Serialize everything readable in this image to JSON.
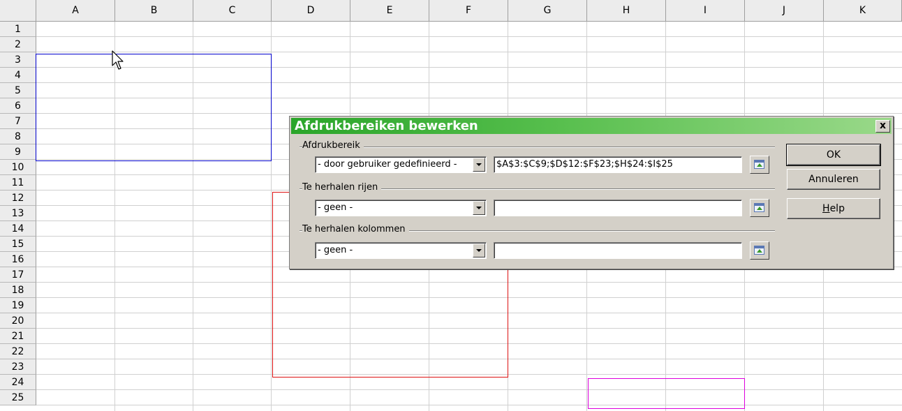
{
  "spreadsheet": {
    "columns": [
      "A",
      "B",
      "C",
      "D",
      "E",
      "F",
      "G",
      "H",
      "I",
      "J",
      "K"
    ],
    "rows": [
      "1",
      "2",
      "3",
      "4",
      "5",
      "6",
      "7",
      "8",
      "9",
      "10",
      "11",
      "12",
      "13",
      "14",
      "15",
      "16",
      "17",
      "18",
      "19",
      "20",
      "21",
      "22",
      "23",
      "24",
      "25"
    ]
  },
  "print_ranges": [
    {
      "ref": "$A$3:$C$9",
      "color": "#0000cc"
    },
    {
      "ref": "$D$12:$F$23",
      "color": "#dd1111"
    },
    {
      "ref": "$H$24:$I$25",
      "color": "#dd00dd"
    }
  ],
  "dialog": {
    "title": "Afdrukbereiken bewerken",
    "close_label": "x",
    "print_range": {
      "label": "Afdrukbereik",
      "selected": "- door gebruiker gedefinieerd -",
      "value": "$A$3:$C$9;$D$12:$F$23;$H$24:$I$25"
    },
    "repeat_rows": {
      "label": "Te herhalen rijen",
      "selected": "- geen -",
      "value": ""
    },
    "repeat_columns": {
      "label": "Te herhalen kolommen",
      "selected": "- geen -",
      "value": ""
    },
    "buttons": {
      "ok": "OK",
      "cancel": "Annuleren",
      "help_prefix": "H",
      "help_rest": "elp"
    }
  }
}
